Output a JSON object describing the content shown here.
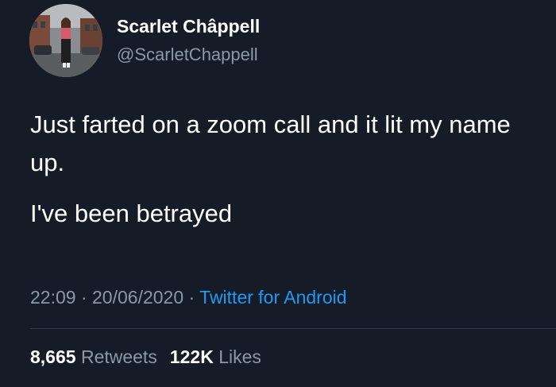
{
  "author": {
    "display_name": "Scarlet Châppell",
    "handle": "@ScarletChappell"
  },
  "tweet": {
    "line1": "Just farted on a zoom call and it lit my name up.",
    "line2": "I've been betrayed"
  },
  "meta": {
    "time": "22:09",
    "separator1": " · ",
    "date": "20/06/2020",
    "separator2": " · ",
    "source": "Twitter for Android"
  },
  "stats": {
    "retweets_count": "8,665",
    "retweets_label": " Retweets",
    "likes_count": "122K",
    "likes_label": " Likes"
  },
  "colors": {
    "background": "#151c27",
    "secondary_text": "#8b98a5",
    "link": "#1d9bf0"
  }
}
